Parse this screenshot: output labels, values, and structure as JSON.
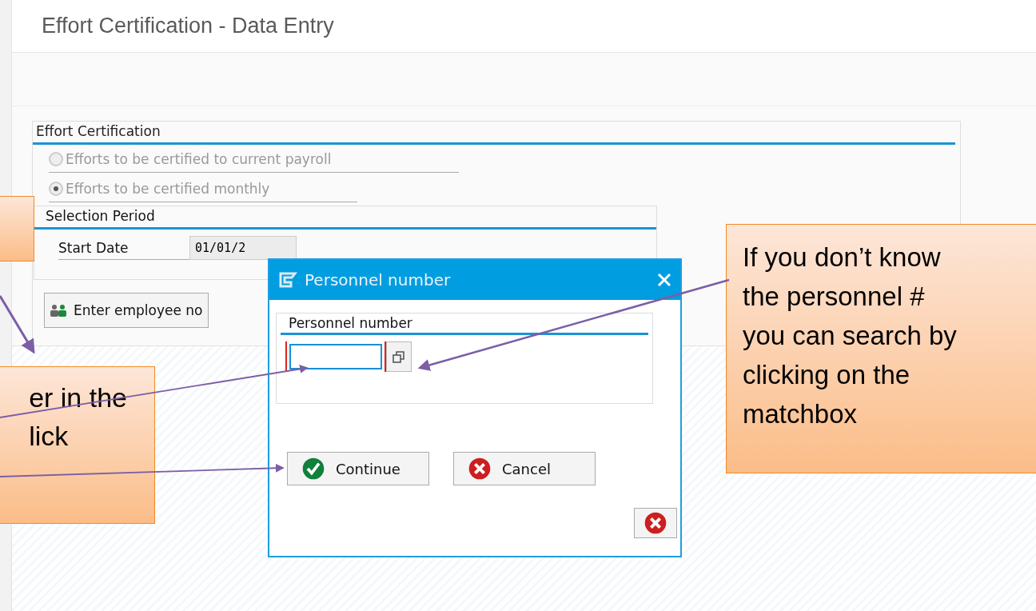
{
  "window": {
    "title": "Effort Certification - Data Entry"
  },
  "certification": {
    "title": "Effort Certification",
    "options": [
      {
        "label": "Efforts to be certified to current payroll",
        "selected": false,
        "disabled": true
      },
      {
        "label": "Efforts to be certified monthly",
        "selected": true,
        "disabled": true
      }
    ]
  },
  "selection_period": {
    "title": "Selection Period",
    "start_date": {
      "label": "Start Date",
      "value": "01/01/2"
    }
  },
  "employee_button": {
    "label": "Enter employee no"
  },
  "dialog": {
    "title": "Personnel number",
    "section_title": "Personnel number",
    "buttons": [
      {
        "label": "Continue",
        "kind": "confirm"
      },
      {
        "label": "Cancel",
        "kind": "cancel"
      }
    ]
  },
  "callouts": [
    {
      "lines": [
        "er in the",
        "lick"
      ]
    },
    {
      "lines": [
        "If you don’t know",
        "the personnel #",
        "you can search by",
        "clicking on the",
        "matchbox"
      ]
    }
  ]
}
